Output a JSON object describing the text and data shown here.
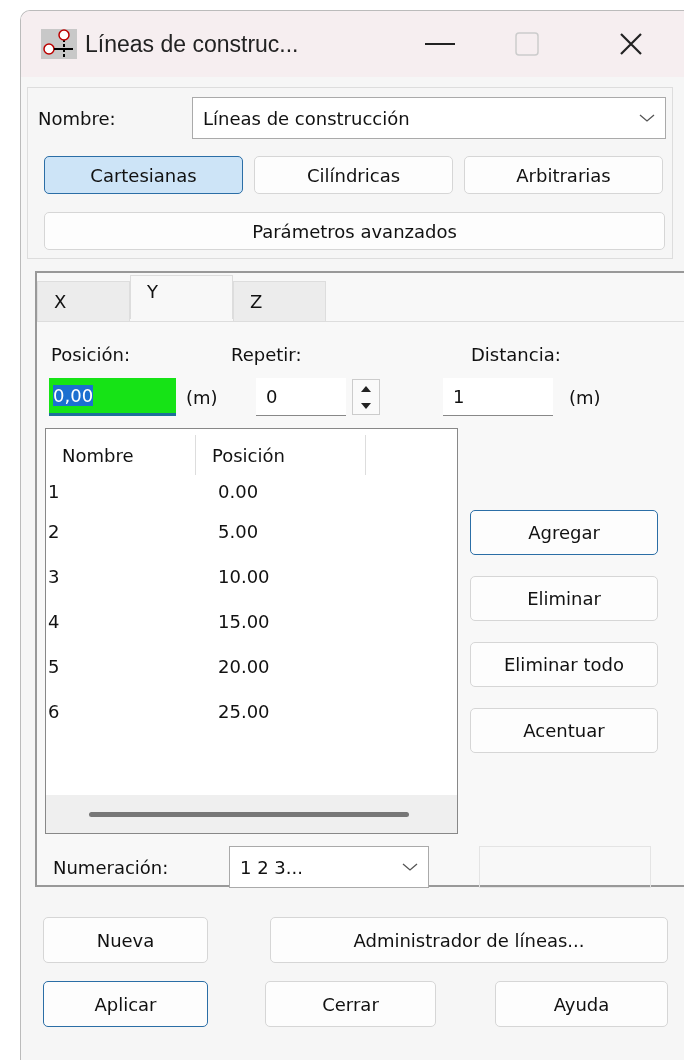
{
  "window": {
    "title": "Líneas de construc..."
  },
  "name_field": {
    "label": "Nombre:",
    "value": "Líneas de construcción"
  },
  "mode_buttons": [
    {
      "label": "Cartesianas",
      "selected": true
    },
    {
      "label": "Cilíndricas",
      "selected": false
    },
    {
      "label": "Arbitrarias",
      "selected": false
    }
  ],
  "advanced_button": "Parámetros avanzados",
  "tabs": [
    {
      "label": "X",
      "selected": false
    },
    {
      "label": "Y",
      "selected": true
    },
    {
      "label": "Z",
      "selected": false
    }
  ],
  "position": {
    "label": "Posición:",
    "value": "0,00",
    "unit": "(m)"
  },
  "repeat": {
    "label": "Repetir:",
    "value": "0"
  },
  "distance": {
    "label": "Distancia:",
    "value": "1",
    "unit": "(m)"
  },
  "table": {
    "columns": [
      "Nombre",
      "Posición"
    ],
    "rows": [
      [
        "1",
        "0.00"
      ],
      [
        "2",
        "5.00"
      ],
      [
        "3",
        "10.00"
      ],
      [
        "4",
        "15.00"
      ],
      [
        "5",
        "20.00"
      ],
      [
        "6",
        "25.00"
      ]
    ]
  },
  "side_buttons": [
    {
      "label": "Agregar",
      "default": true
    },
    {
      "label": "Eliminar",
      "default": false
    },
    {
      "label": "Eliminar todo",
      "default": false
    },
    {
      "label": "Acentuar",
      "default": false
    }
  ],
  "numbering": {
    "label": "Numeración:",
    "value": "1 2 3..."
  },
  "bottom_rows": [
    [
      {
        "label": "Nueva",
        "default": false
      },
      {
        "label": "Administrador de líneas...",
        "default": false
      }
    ],
    [
      {
        "label": "Aplicar",
        "default": true
      },
      {
        "label": "Cerrar",
        "default": false
      },
      {
        "label": "Ayuda",
        "default": false
      }
    ]
  ]
}
